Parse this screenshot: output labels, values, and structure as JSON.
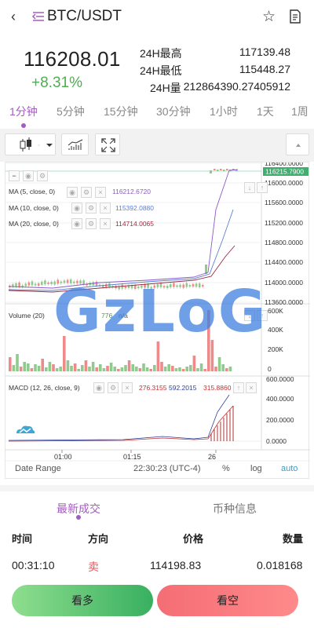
{
  "header": {
    "title": "BTC/USDT",
    "back_icon": "chevron-left-icon",
    "pair_icon": "switch-pair-icon",
    "star_icon": "star-icon",
    "info_icon": "document-icon"
  },
  "ticker": {
    "last_price": "116208.01",
    "change_pct": "+8.31%",
    "change_color": "#4caf50",
    "high_label": "24H最高",
    "high_value": "117139.48",
    "low_label": "24H最低",
    "low_value": "115448.27",
    "volume_label": "24H量",
    "volume_value": "212864390.27405912"
  },
  "periods": {
    "items": [
      "1分钟",
      "5分钟",
      "15分钟",
      "30分钟",
      "1小时",
      "1天",
      "1周"
    ],
    "active_index": 0
  },
  "toolbar": {
    "candle_icon": "candlestick-icon",
    "dropdown_icon": "caret-down-icon",
    "indicator_icon": "indicator-icon",
    "fullscreen_icon": "fullscreen-icon",
    "collapse_icon": "caret-up-icon"
  },
  "chart": {
    "indicators": [
      {
        "label": "MA (5, close, 0)",
        "value": "116212.6720",
        "color": "#8b59c9"
      },
      {
        "label": "MA (10, close, 0)",
        "value": "115392.0880",
        "color": "#5a7fd6"
      },
      {
        "label": "MA (20, close, 0)",
        "value": "114714.0065",
        "color": "#9b2a40"
      }
    ],
    "price_ticks": [
      "116400.0000",
      "116000.0000",
      "115600.0000",
      "115200.0000",
      "114800.0000",
      "114400.0000",
      "114000.0000",
      "113600.0000"
    ],
    "last_price_label": "116215.7900",
    "volume_label": "Volume (20)",
    "volume_value": "776",
    "volume_value2": "n/a",
    "volume_ticks": [
      "600K",
      "400K",
      "200K",
      "0"
    ],
    "macd_label": "MACD (12, 26, close, 9)",
    "macd_values": [
      "276.3155",
      "592.2015",
      "315.8860"
    ],
    "macd_ticks": [
      "600.0000",
      "400.0000",
      "200.0000",
      "0.0000"
    ],
    "time_ticks": [
      "01:00",
      "01:15",
      "26"
    ],
    "date_range": "Date Range",
    "clock": "22:30:23 (UTC-4)",
    "percent": "%",
    "log": "log",
    "auto": "auto",
    "up_color": "#8fca8f",
    "down_color": "#ef8a8a"
  },
  "watermark": "GzLoG",
  "bottom_tabs": {
    "items": [
      "最新成交",
      "币种信息"
    ],
    "active_index": 0
  },
  "trades": {
    "headers": [
      "时间",
      "方向",
      "价格",
      "数量"
    ],
    "rows": [
      {
        "time": "00:31:10",
        "side": "卖",
        "price": "114198.83",
        "amount": "0.018168"
      }
    ]
  },
  "actions": {
    "long_label": "看多",
    "short_label": "看空"
  }
}
